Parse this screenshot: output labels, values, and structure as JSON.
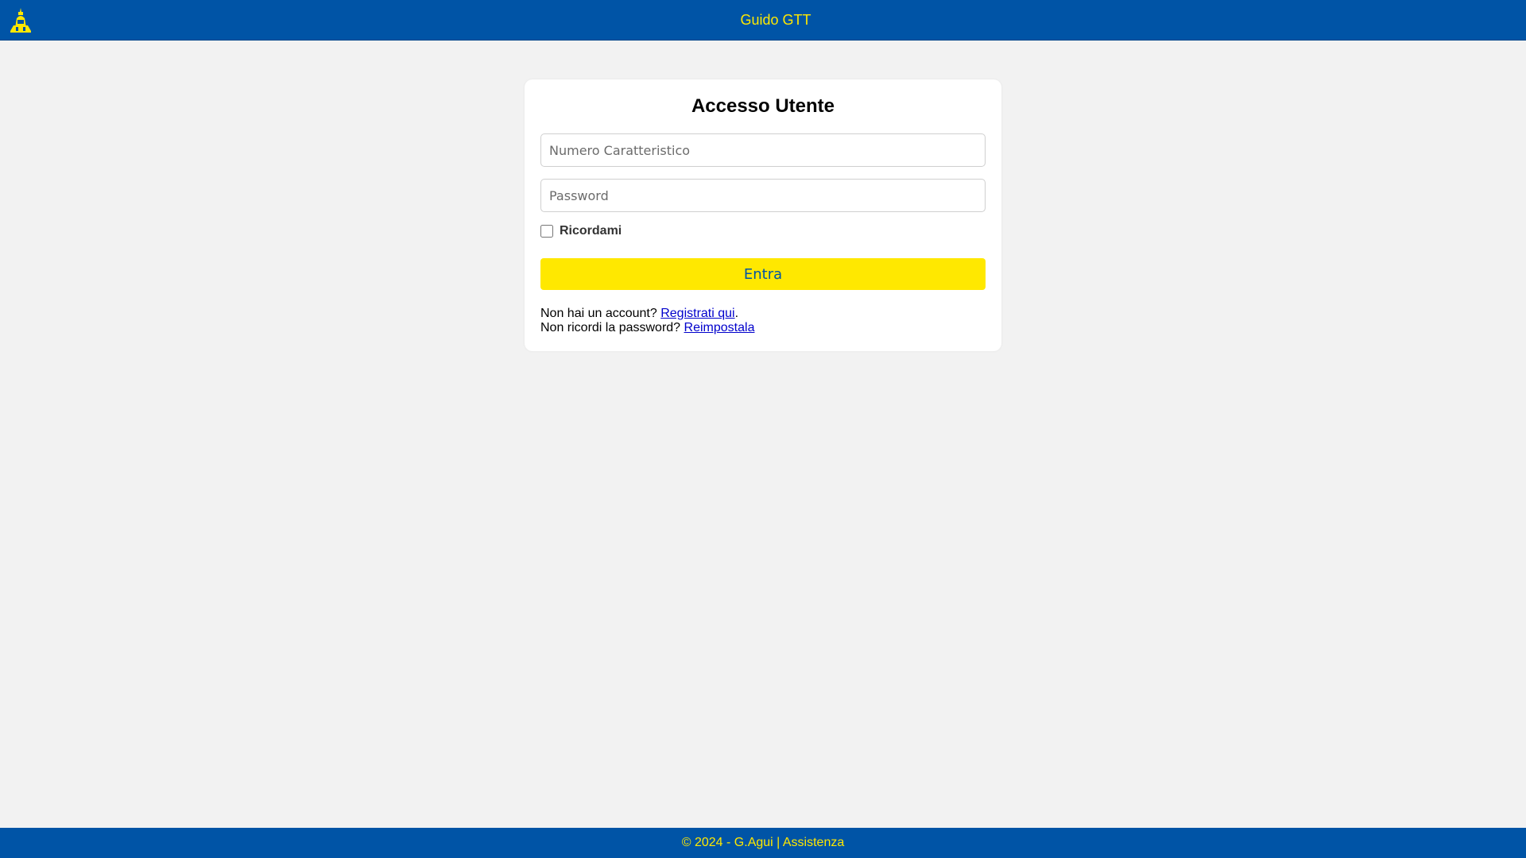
{
  "colors": {
    "brand_blue": "#0054a6",
    "brand_yellow": "#ffe800",
    "background": "#f2f2f2",
    "link": "#0000cc"
  },
  "header": {
    "logo_icon": "mole-antonelliana-logo-icon",
    "title": "Guido GTT"
  },
  "login": {
    "title": "Accesso Utente",
    "username_placeholder": "Numero Caratteristico",
    "username_value": "",
    "password_placeholder": "Password",
    "password_value": "",
    "remember_label": "Ricordami",
    "remember_checked": false,
    "submit_label": "Entra",
    "register_prompt": "Non hai un account? ",
    "register_link": "Registrati qui",
    "register_suffix": ".",
    "reset_prompt": "Non ricordi la password? ",
    "reset_link": "Reimpostala"
  },
  "footer": {
    "copyright": "© 2024 - G.Agui | ",
    "support_link": "Assistenza"
  }
}
